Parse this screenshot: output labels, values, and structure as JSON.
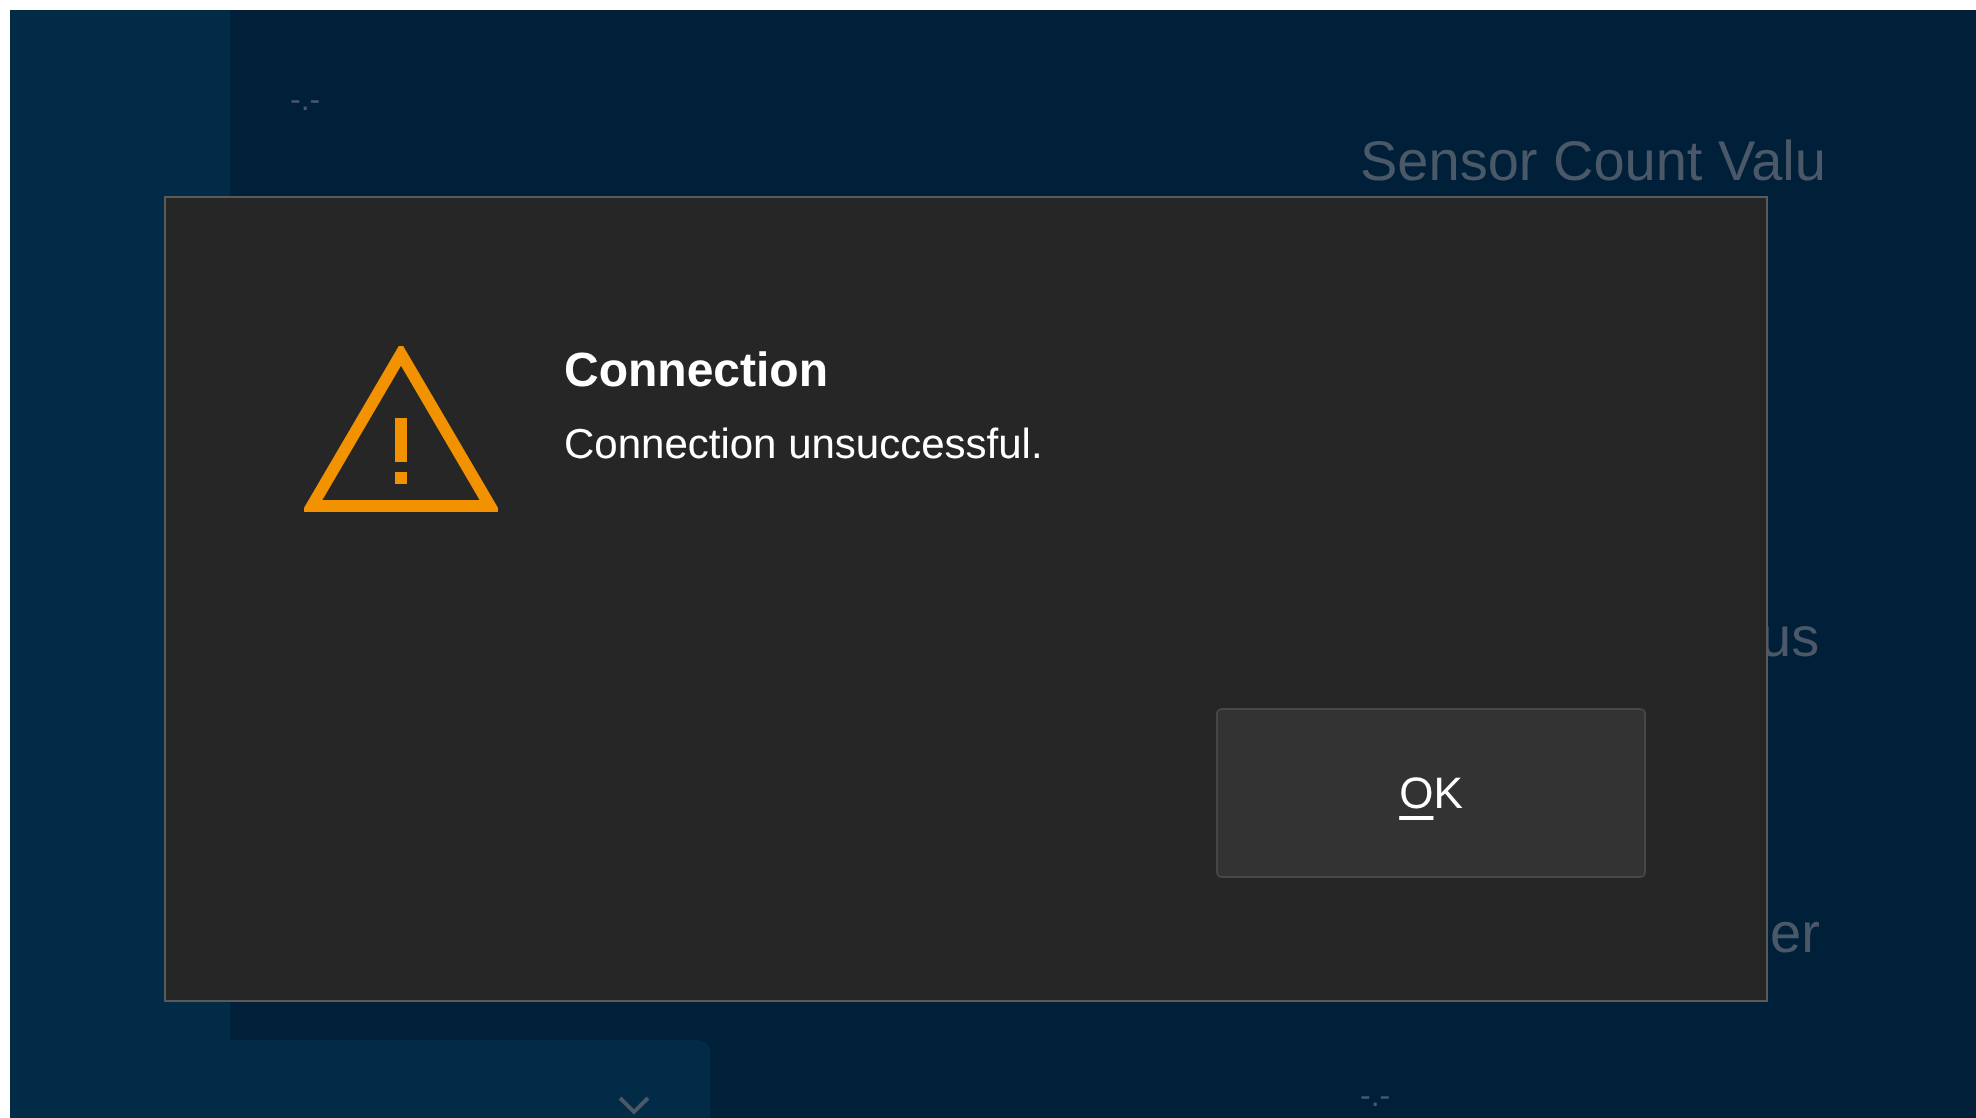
{
  "background": {
    "top_reading": "-.-",
    "label_1": "Sensor Count Valu",
    "label_2": "us",
    "label_3": "er",
    "bottom_reading": "-.-"
  },
  "dialog": {
    "title": "Connection",
    "message": "Connection unsuccessful.",
    "buttons": [
      {
        "label": "OK"
      }
    ]
  }
}
